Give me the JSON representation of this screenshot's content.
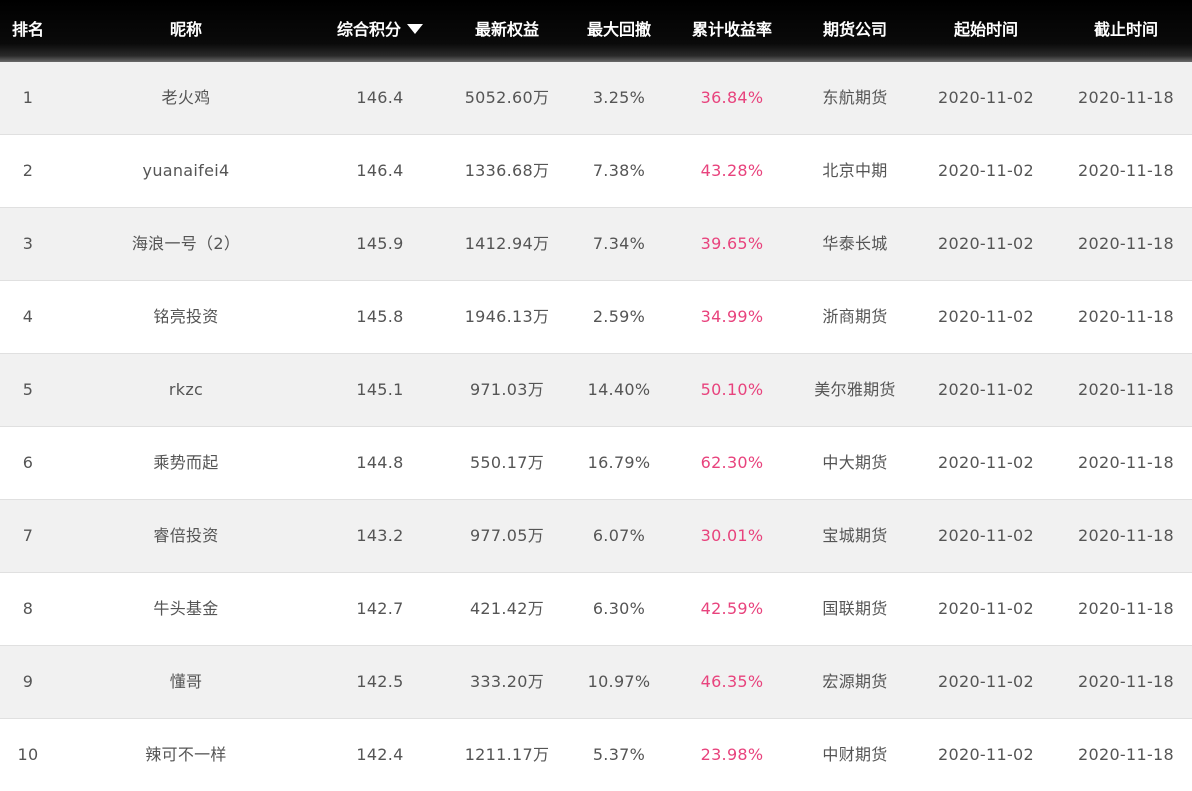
{
  "header": {
    "rank": "排名",
    "nickname": "昵称",
    "score": "综合积分",
    "equity": "最新权益",
    "drawdown": "最大回撤",
    "return": "累计收益率",
    "firm": "期货公司",
    "start": "起始时间",
    "end": "截止时间",
    "sort_icon": "sort-down-triangle"
  },
  "colors": {
    "header_bg": "#000000",
    "return_text": "#e8437d",
    "body_text": "#555555",
    "row_alt": "#f1f1f1"
  },
  "rows": [
    {
      "rank": "1",
      "nickname": "老火鸡",
      "score": "146.4",
      "equity": "5052.60万",
      "drawdown": "3.25%",
      "return": "36.84%",
      "firm": "东航期货",
      "start": "2020-11-02",
      "end": "2020-11-18"
    },
    {
      "rank": "2",
      "nickname": "yuanaifei4",
      "score": "146.4",
      "equity": "1336.68万",
      "drawdown": "7.38%",
      "return": "43.28%",
      "firm": "北京中期",
      "start": "2020-11-02",
      "end": "2020-11-18"
    },
    {
      "rank": "3",
      "nickname": "海浪一号（2）",
      "score": "145.9",
      "equity": "1412.94万",
      "drawdown": "7.34%",
      "return": "39.65%",
      "firm": "华泰长城",
      "start": "2020-11-02",
      "end": "2020-11-18"
    },
    {
      "rank": "4",
      "nickname": "铭亮投资",
      "score": "145.8",
      "equity": "1946.13万",
      "drawdown": "2.59%",
      "return": "34.99%",
      "firm": "浙商期货",
      "start": "2020-11-02",
      "end": "2020-11-18"
    },
    {
      "rank": "5",
      "nickname": "rkzc",
      "score": "145.1",
      "equity": "971.03万",
      "drawdown": "14.40%",
      "return": "50.10%",
      "firm": "美尔雅期货",
      "start": "2020-11-02",
      "end": "2020-11-18"
    },
    {
      "rank": "6",
      "nickname": "乘势而起",
      "score": "144.8",
      "equity": "550.17万",
      "drawdown": "16.79%",
      "return": "62.30%",
      "firm": "中大期货",
      "start": "2020-11-02",
      "end": "2020-11-18"
    },
    {
      "rank": "7",
      "nickname": "睿倍投资",
      "score": "143.2",
      "equity": "977.05万",
      "drawdown": "6.07%",
      "return": "30.01%",
      "firm": "宝城期货",
      "start": "2020-11-02",
      "end": "2020-11-18"
    },
    {
      "rank": "8",
      "nickname": "牛头基金",
      "score": "142.7",
      "equity": "421.42万",
      "drawdown": "6.30%",
      "return": "42.59%",
      "firm": "国联期货",
      "start": "2020-11-02",
      "end": "2020-11-18"
    },
    {
      "rank": "9",
      "nickname": "懂哥",
      "score": "142.5",
      "equity": "333.20万",
      "drawdown": "10.97%",
      "return": "46.35%",
      "firm": "宏源期货",
      "start": "2020-11-02",
      "end": "2020-11-18"
    },
    {
      "rank": "10",
      "nickname": "辣可不一样",
      "score": "142.4",
      "equity": "1211.17万",
      "drawdown": "5.37%",
      "return": "23.98%",
      "firm": "中财期货",
      "start": "2020-11-02",
      "end": "2020-11-18"
    }
  ]
}
